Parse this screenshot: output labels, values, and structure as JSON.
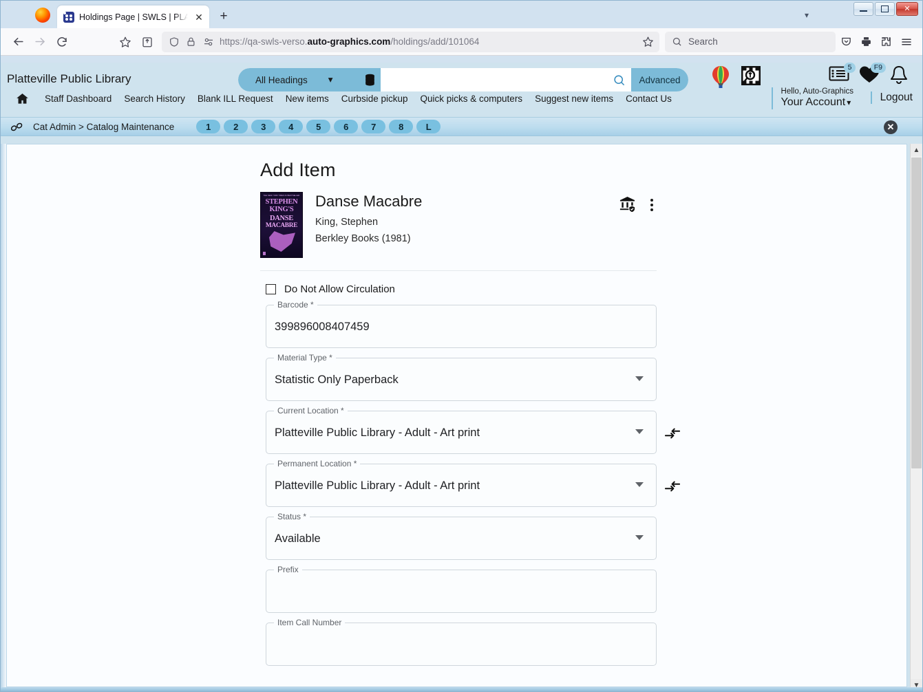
{
  "browser": {
    "tab": {
      "title": "Holdings Page | SWLS | PLATT",
      "favicon_icon": "app-favicon",
      "close_icon": "close-icon"
    },
    "new_tab_label": "+",
    "tab_list_icon": "chevron-down-icon",
    "window_controls": {
      "minimize": "minimize-icon",
      "maximize": "maximize-icon",
      "close": "close-icon"
    },
    "toolbar": {
      "back_icon": "back-arrow-icon",
      "forward_icon": "forward-arrow-icon",
      "reload_icon": "reload-icon",
      "bookmark_icon": "star-icon",
      "save_tab_icon": "save-to-collection-icon",
      "shield_icon": "shield-icon",
      "lock_icon": "padlock-icon",
      "permissions_icon": "permissions-icon",
      "pocket_icon": "pocket-icon",
      "print_icon": "printer-icon",
      "extensions_icon": "extensions-icon",
      "menu_icon": "hamburger-menu-icon"
    },
    "url": {
      "scheme": "https://qa-swls-verso.",
      "domain": "auto-graphics.com",
      "path": "/holdings/add/101064"
    },
    "search": {
      "placeholder": "Search",
      "icon": "search-icon"
    }
  },
  "app_header": {
    "library_name": "Platteville Public Library",
    "search_scope": "All Headings",
    "scope_chevron_icon": "chevron-down-icon",
    "database_icon": "database-icon",
    "search_value": "",
    "search_icon": "search-icon",
    "advanced_label": "Advanced",
    "icons": {
      "balloon": "hot-air-balloon-icon",
      "discover": "image-search-icon",
      "lists": "my-lists-icon",
      "favorites": "heart-icon",
      "alerts": "bell-icon"
    },
    "badges": {
      "lists": "5",
      "favorites": "F9"
    },
    "account": {
      "greeting": "Hello, Auto-Graphics",
      "label": "Your Account",
      "chevron_icon": "chevron-down-icon"
    },
    "logout_label": "Logout",
    "nav": {
      "home_icon": "home-icon",
      "links": [
        "Staff Dashboard",
        "Search History",
        "Blank ILL Request",
        "New items",
        "Curbside pickup",
        "Quick picks & computers",
        "Suggest new items",
        "Contact Us"
      ]
    }
  },
  "breadcrumb": {
    "link_icon": "chain-link-icon",
    "text": "Cat Admin > Catalog Maintenance",
    "page_chips": [
      "1",
      "2",
      "3",
      "4",
      "5",
      "6",
      "7",
      "8",
      "L"
    ],
    "close_icon": "close-circle-icon"
  },
  "main": {
    "page_title": "Add Item",
    "bib": {
      "cover": {
        "banner": "THE NEW YORK TIMES #1 BESTSELLER",
        "line1": "STEPHEN",
        "line2": "KING'S",
        "line3": "DANSE",
        "line4": "MACABRE"
      },
      "title": "Danse Macabre",
      "author": "King, Stephen",
      "publisher": "Berkley Books (1981)",
      "holdings_icon": "library-holdings-icon",
      "more_icon": "kebab-menu-icon"
    },
    "checkbox": {
      "label": "Do Not Allow Circulation",
      "checked": false
    },
    "fields": [
      {
        "label": "Barcode *",
        "value": "399896008407459",
        "type": "text"
      },
      {
        "label": "Material Type *",
        "value": "Statistic Only Paperback",
        "type": "select"
      },
      {
        "label": "Current Location *",
        "value": "Platteville Public Library - Adult - Art print",
        "type": "select",
        "side_icon": "transfer-arrow-icon"
      },
      {
        "label": "Permanent Location *",
        "value": "Platteville Public Library - Adult - Art print",
        "type": "select",
        "side_icon": "transfer-arrow-icon"
      },
      {
        "label": "Status *",
        "value": "Available",
        "type": "select"
      },
      {
        "label": "Prefix",
        "value": "",
        "type": "text"
      },
      {
        "label": "Item Call Number",
        "value": "",
        "type": "text"
      }
    ]
  },
  "scrollbar": {
    "up_icon": "chevron-up-icon",
    "down_icon": "chevron-down-icon"
  },
  "colors": {
    "header_bg": "#cfe3ee",
    "accent": "#7cbbd8",
    "chip": "#79c0e0"
  }
}
